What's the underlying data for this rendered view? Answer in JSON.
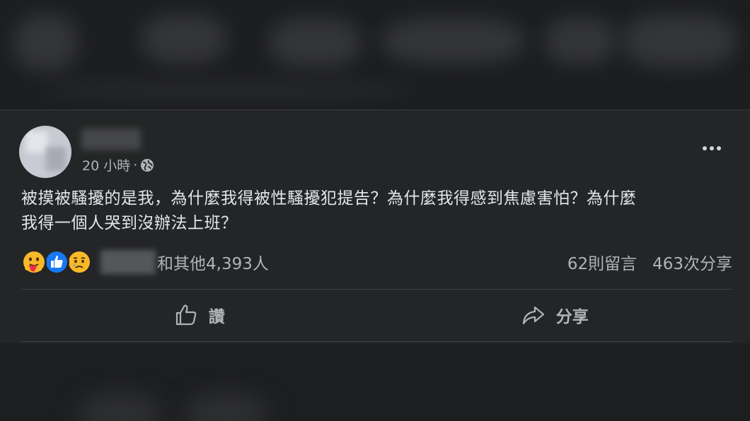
{
  "post": {
    "timestamp": "20 小時",
    "separator": "·",
    "visibility_icon": "globe-icon",
    "text_line1": "被摸被騷擾的是我，為什麼我得被性騷擾犯提告？為什麼我得感到焦慮害怕？為什麼",
    "text_line2": "我得一個人哭到沒辦法上班？",
    "reaction_icons": [
      "care-emoji",
      "like-emoji",
      "sad-emoji"
    ],
    "others_text": "和其他4,393人",
    "comments_count": "62則留言",
    "shares_count": "463次分享"
  },
  "actions": {
    "like_label": "讚",
    "share_label": "分享"
  },
  "colors": {
    "card_bg": "#242526",
    "text_primary": "#e4e6eb",
    "text_secondary": "#b0b3b8",
    "like_blue": "#1877f2",
    "emoji_yellow": "#f7b928"
  }
}
